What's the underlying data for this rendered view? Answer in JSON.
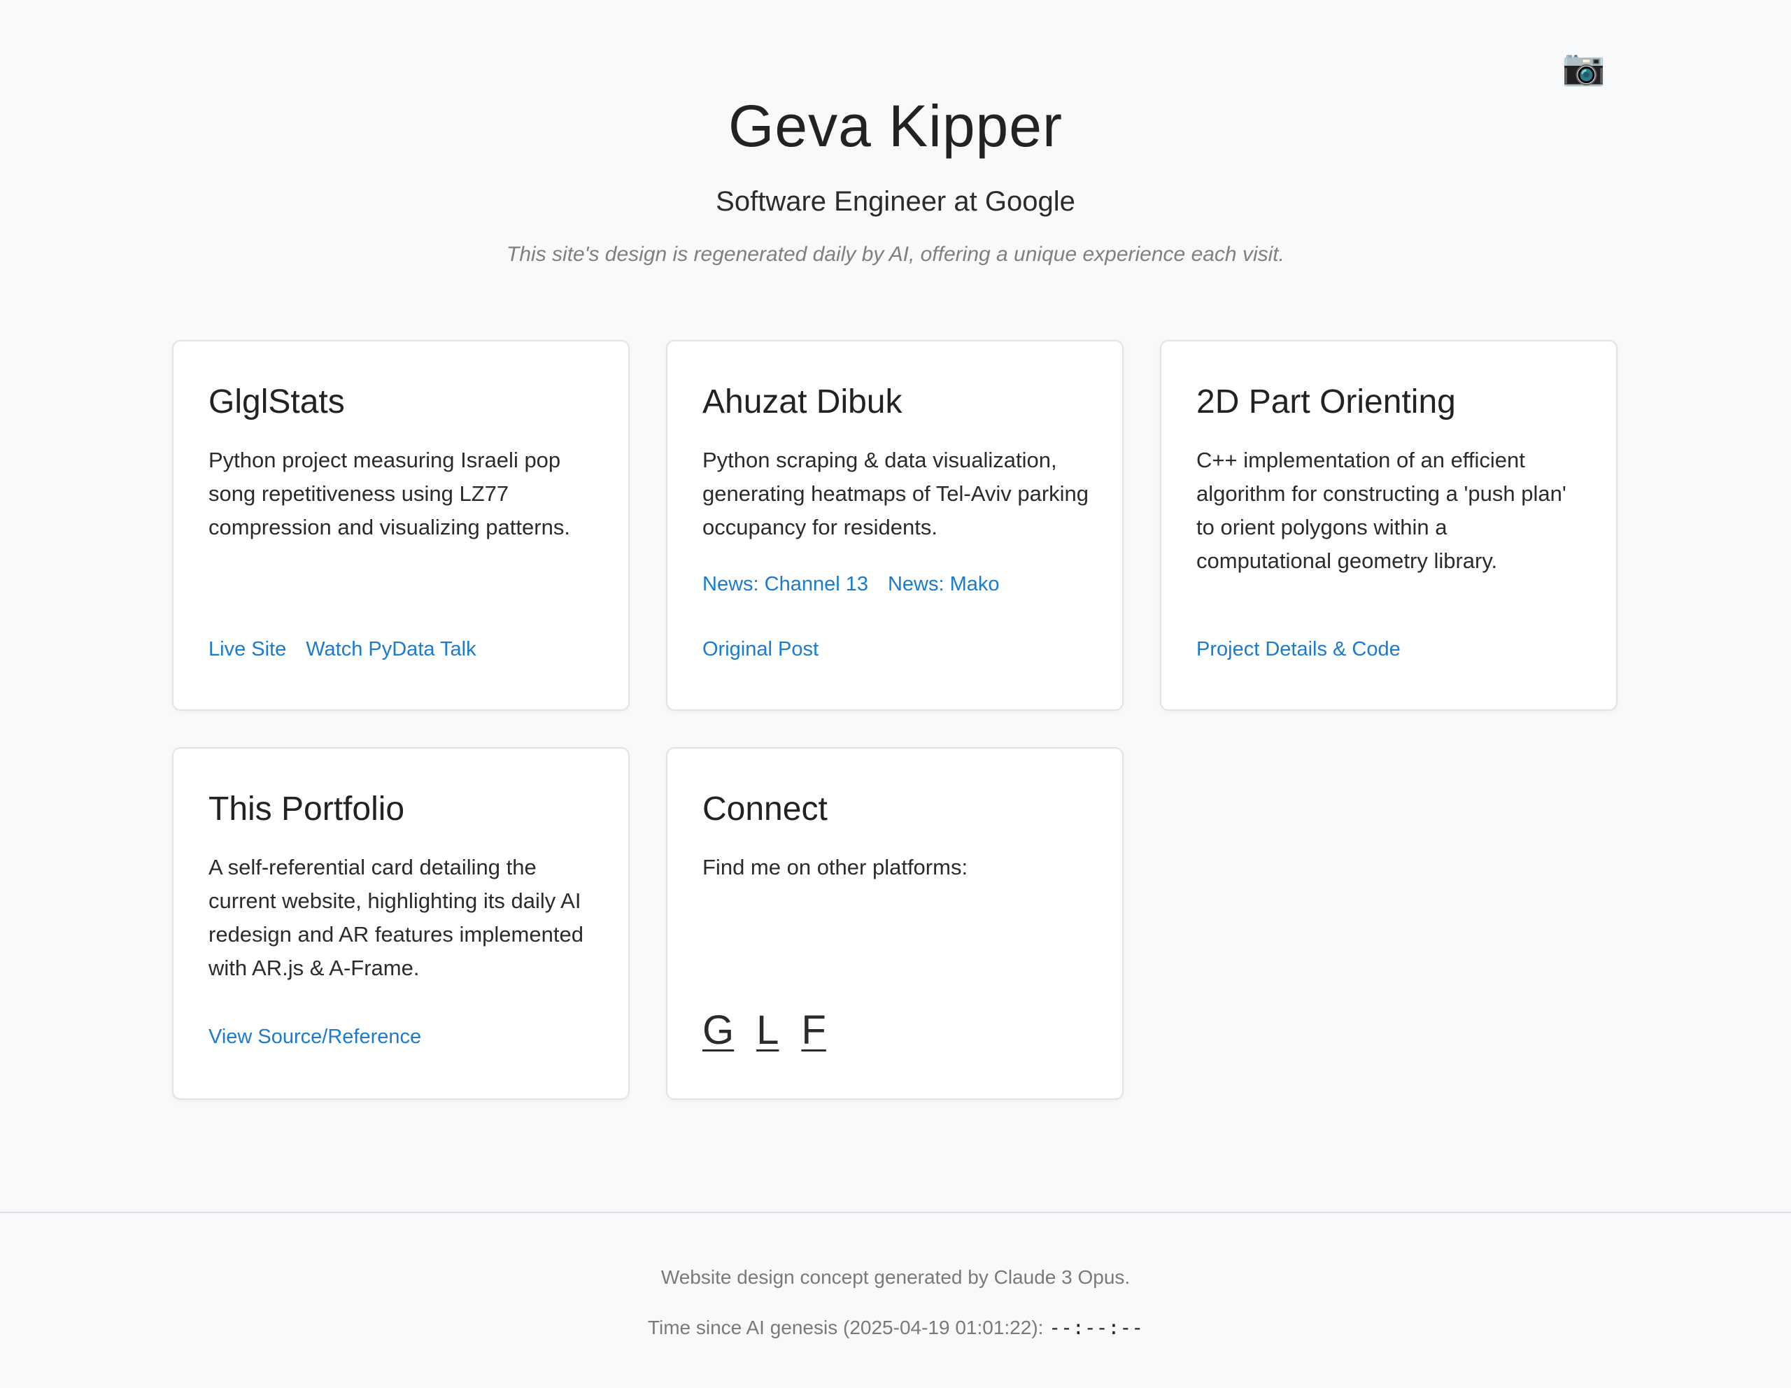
{
  "header": {
    "name": "Geva Kipper",
    "subtitle": "Software Engineer at Google",
    "tagline": "This site's design is regenerated daily by AI, offering a unique experience each visit.",
    "camera_icon": "📷"
  },
  "cards": [
    {
      "title": "GlglStats",
      "description": "Python project measuring Israeli pop song repetitiveness using LZ77 compression and visualizing patterns.",
      "links": [
        "Live Site",
        "Watch PyData Talk"
      ]
    },
    {
      "title": "Ahuzat Dibuk",
      "description": "Python scraping & data visualization, generating heatmaps of Tel-Aviv parking occupancy for residents.",
      "news_links": [
        "News: Channel 13",
        "News: Mako"
      ],
      "links": [
        "Original Post"
      ]
    },
    {
      "title": "2D Part Orienting",
      "description": "C++ implementation of an efficient algorithm for constructing a 'push plan' to orient polygons within a computational geometry library.",
      "links": [
        "Project Details & Code"
      ]
    },
    {
      "title": "This Portfolio",
      "description": "A self-referential card detailing the current website, highlighting its daily AI redesign and AR features implemented with AR.js & A-Frame.",
      "links": [
        "View Source/Reference"
      ]
    },
    {
      "title": "Connect",
      "description": "Find me on other platforms:",
      "social": [
        "G",
        "L",
        "F"
      ]
    }
  ],
  "footer": {
    "credit": "Website design concept generated by Claude 3 Opus.",
    "timer_label": "Time since AI genesis (2025-04-19 01:01:22): ",
    "timer_value": "--:--:--"
  }
}
